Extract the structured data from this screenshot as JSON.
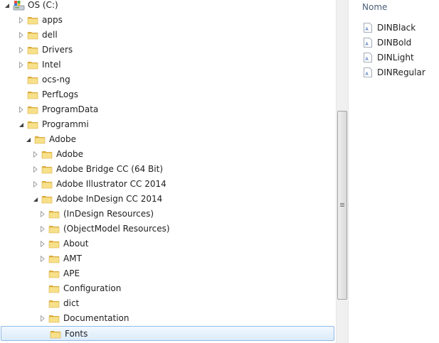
{
  "tree": {
    "items": [
      {
        "label": "OS (C:)",
        "level": 0,
        "expander": "open",
        "icon": "drive-icon"
      },
      {
        "label": "apps",
        "level": 1,
        "expander": "closed",
        "icon": "folder-icon"
      },
      {
        "label": "dell",
        "level": 1,
        "expander": "closed",
        "icon": "folder-icon"
      },
      {
        "label": "Drivers",
        "level": 1,
        "expander": "closed",
        "icon": "folder-icon"
      },
      {
        "label": "Intel",
        "level": 1,
        "expander": "closed",
        "icon": "folder-icon"
      },
      {
        "label": "ocs-ng",
        "level": 1,
        "expander": "none",
        "icon": "folder-icon"
      },
      {
        "label": "PerfLogs",
        "level": 1,
        "expander": "none",
        "icon": "folder-icon"
      },
      {
        "label": "ProgramData",
        "level": 1,
        "expander": "closed",
        "icon": "folder-icon"
      },
      {
        "label": "Programmi",
        "level": 1,
        "expander": "open",
        "icon": "folder-icon"
      },
      {
        "label": "Adobe",
        "level": 2,
        "expander": "open",
        "icon": "folder-icon"
      },
      {
        "label": "Adobe",
        "level": 3,
        "expander": "closed",
        "icon": "folder-icon"
      },
      {
        "label": "Adobe Bridge CC (64 Bit)",
        "level": 3,
        "expander": "closed",
        "icon": "folder-icon"
      },
      {
        "label": "Adobe Illustrator CC 2014",
        "level": 3,
        "expander": "closed",
        "icon": "folder-icon"
      },
      {
        "label": "Adobe InDesign CC 2014",
        "level": 3,
        "expander": "open",
        "icon": "folder-icon"
      },
      {
        "label": "(InDesign Resources)",
        "level": 4,
        "expander": "closed",
        "icon": "folder-icon"
      },
      {
        "label": "(ObjectModel Resources)",
        "level": 4,
        "expander": "closed",
        "icon": "folder-icon"
      },
      {
        "label": "About",
        "level": 4,
        "expander": "closed",
        "icon": "folder-icon"
      },
      {
        "label": "AMT",
        "level": 4,
        "expander": "closed",
        "icon": "folder-icon"
      },
      {
        "label": "APE",
        "level": 4,
        "expander": "none",
        "icon": "folder-icon"
      },
      {
        "label": "Configuration",
        "level": 4,
        "expander": "none",
        "icon": "folder-icon"
      },
      {
        "label": "dict",
        "level": 4,
        "expander": "none",
        "icon": "folder-icon"
      },
      {
        "label": "Documentation",
        "level": 4,
        "expander": "closed",
        "icon": "folder-icon"
      },
      {
        "label": "Fonts",
        "level": 4,
        "expander": "none",
        "icon": "folder-icon",
        "selected": true
      }
    ]
  },
  "list": {
    "column_header": "Nome",
    "files": [
      {
        "label": "DINBlack",
        "icon": "font-file-icon"
      },
      {
        "label": "DINBold",
        "icon": "font-file-icon"
      },
      {
        "label": "DINLight",
        "icon": "font-file-icon"
      },
      {
        "label": "DINRegular",
        "icon": "font-file-icon"
      }
    ]
  },
  "colors": {
    "selection_fill": "#dcecfc",
    "selection_border": "#8fb9e6",
    "folder_light": "#f7e08a",
    "folder_dark": "#d9a93a",
    "header_text": "#4c607a"
  }
}
